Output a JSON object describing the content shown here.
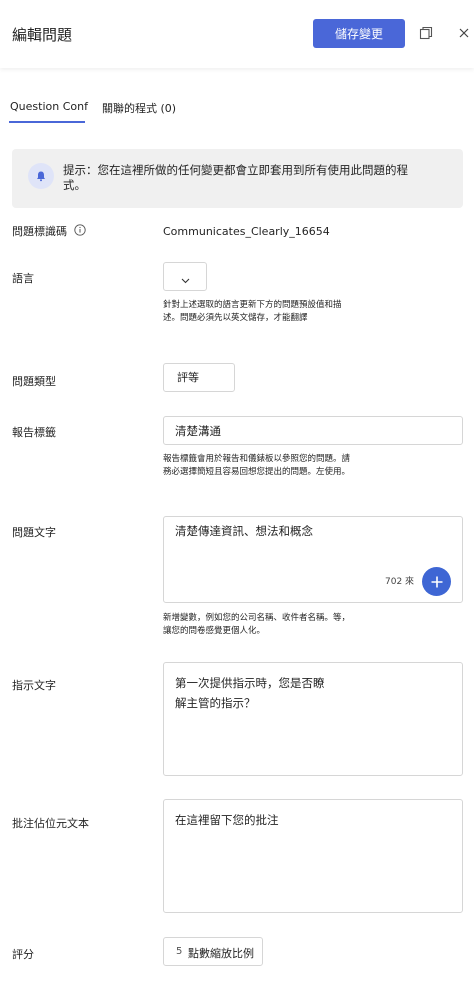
{
  "header": {
    "title": "編輯問題",
    "save_label": "儲存變更"
  },
  "tabs": [
    {
      "label": "Question Conf",
      "active": true
    },
    {
      "label": "關聯的程式 (0)",
      "active": false
    }
  ],
  "tip": {
    "text": "提示：您在這裡所做的任何變更都會立即套用到所有使用此問題的程式。"
  },
  "fields": {
    "question_id": {
      "label": "問題標識碼",
      "value": "Communicates_Clearly_16654"
    },
    "language": {
      "label": "語言",
      "help": "針對上述選取的語言更新下方的問題預設值和描述。問題必須先以英文儲存，才能翻譯"
    },
    "question_type": {
      "label": "問題類型",
      "value": "評等"
    },
    "report_label": {
      "label": "報告標籤",
      "value": "清楚溝通",
      "help": "報告標籤會用於報告和儀錶板以參照您的問題。請務必選擇簡短且容易回想您提出的問題。左使用。"
    },
    "question_text": {
      "label": "問題文字",
      "value": "清楚傳達資訊、想法和概念",
      "char_count": "702 來",
      "help": "新增變數，例如您的公司名稱、收件者名稱。等，讓您的問卷感覺更個人化。"
    },
    "instruction_text": {
      "label": "指示文字",
      "value": "第一次提供指示時，您是否瞭解主管的指示？"
    },
    "comment_placeholder": {
      "label": "批注佔位元文本",
      "value": "在這裡留下您的批注"
    },
    "rating": {
      "label": "評分",
      "value_num": "5",
      "value_text": "點數縮放比例"
    }
  },
  "colors": {
    "accent": "#4a67d8",
    "tip_bg": "#f0f0f0"
  }
}
